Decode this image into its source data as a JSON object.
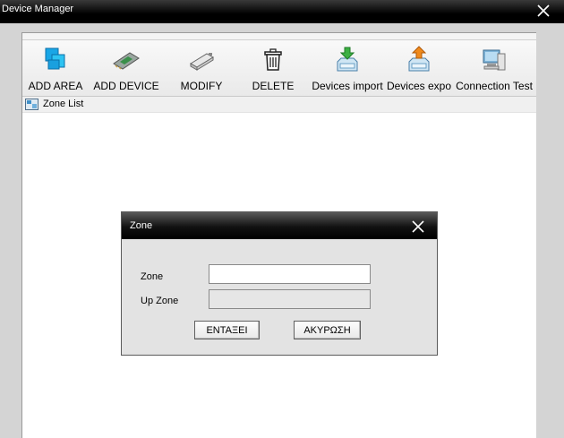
{
  "window": {
    "title": "Device Manager",
    "close_icon": "close-icon"
  },
  "toolbar": {
    "items": [
      {
        "label": "ADD AREA",
        "icon": "add-area-icon"
      },
      {
        "label": "ADD DEVICE",
        "icon": "add-device-icon"
      },
      {
        "label": "MODIFY",
        "icon": "modify-icon"
      },
      {
        "label": "DELETE",
        "icon": "trash-icon"
      },
      {
        "label": "Devices import",
        "icon": "import-icon"
      },
      {
        "label": "Devices expo",
        "icon": "export-icon"
      },
      {
        "label": "Connection  Test",
        "icon": "connection-test-icon"
      }
    ]
  },
  "zone_list": {
    "label": "Zone List",
    "icon": "zone-list-icon"
  },
  "dialog": {
    "title": "Zone",
    "zone_label": "Zone",
    "zone_value": "",
    "up_zone_label": "Up Zone",
    "up_zone_value": "",
    "ok_label": "ΕΝΤΑΞΕΙ",
    "cancel_label": "ΑΚΥΡΩΣΗ"
  },
  "colors": {
    "titlebar": "#000000",
    "dialog_bg": "#e3e3e3",
    "toolbar_bg": "#eeeeee"
  }
}
